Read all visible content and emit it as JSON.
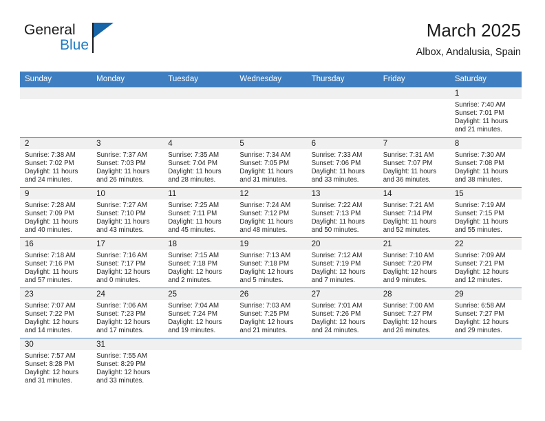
{
  "brand": {
    "line1": "General",
    "line2": "Blue",
    "accent_color": "#1d7bc4",
    "flag_color": "#1565a8"
  },
  "header": {
    "title": "March 2025",
    "subtitle": "Albox, Andalusia, Spain"
  },
  "calendar": {
    "header_bg": "#3f7fc1",
    "daynum_bg": "#f0f0f0",
    "weekday_headers": [
      "Sunday",
      "Monday",
      "Tuesday",
      "Wednesday",
      "Thursday",
      "Friday",
      "Saturday"
    ],
    "weeks": [
      [
        {
          "day": "",
          "blank": true,
          "sunrise": "",
          "sunset": "",
          "daylight_line1": "",
          "daylight_line2": ""
        },
        {
          "day": "",
          "blank": true,
          "sunrise": "",
          "sunset": "",
          "daylight_line1": "",
          "daylight_line2": ""
        },
        {
          "day": "",
          "blank": true,
          "sunrise": "",
          "sunset": "",
          "daylight_line1": "",
          "daylight_line2": ""
        },
        {
          "day": "",
          "blank": true,
          "sunrise": "",
          "sunset": "",
          "daylight_line1": "",
          "daylight_line2": ""
        },
        {
          "day": "",
          "blank": true,
          "sunrise": "",
          "sunset": "",
          "daylight_line1": "",
          "daylight_line2": ""
        },
        {
          "day": "",
          "blank": true,
          "sunrise": "",
          "sunset": "",
          "daylight_line1": "",
          "daylight_line2": ""
        },
        {
          "day": "1",
          "blank": false,
          "sunrise": "Sunrise: 7:40 AM",
          "sunset": "Sunset: 7:01 PM",
          "daylight_line1": "Daylight: 11 hours",
          "daylight_line2": "and 21 minutes."
        }
      ],
      [
        {
          "day": "2",
          "blank": false,
          "sunrise": "Sunrise: 7:38 AM",
          "sunset": "Sunset: 7:02 PM",
          "daylight_line1": "Daylight: 11 hours",
          "daylight_line2": "and 24 minutes."
        },
        {
          "day": "3",
          "blank": false,
          "sunrise": "Sunrise: 7:37 AM",
          "sunset": "Sunset: 7:03 PM",
          "daylight_line1": "Daylight: 11 hours",
          "daylight_line2": "and 26 minutes."
        },
        {
          "day": "4",
          "blank": false,
          "sunrise": "Sunrise: 7:35 AM",
          "sunset": "Sunset: 7:04 PM",
          "daylight_line1": "Daylight: 11 hours",
          "daylight_line2": "and 28 minutes."
        },
        {
          "day": "5",
          "blank": false,
          "sunrise": "Sunrise: 7:34 AM",
          "sunset": "Sunset: 7:05 PM",
          "daylight_line1": "Daylight: 11 hours",
          "daylight_line2": "and 31 minutes."
        },
        {
          "day": "6",
          "blank": false,
          "sunrise": "Sunrise: 7:33 AM",
          "sunset": "Sunset: 7:06 PM",
          "daylight_line1": "Daylight: 11 hours",
          "daylight_line2": "and 33 minutes."
        },
        {
          "day": "7",
          "blank": false,
          "sunrise": "Sunrise: 7:31 AM",
          "sunset": "Sunset: 7:07 PM",
          "daylight_line1": "Daylight: 11 hours",
          "daylight_line2": "and 36 minutes."
        },
        {
          "day": "8",
          "blank": false,
          "sunrise": "Sunrise: 7:30 AM",
          "sunset": "Sunset: 7:08 PM",
          "daylight_line1": "Daylight: 11 hours",
          "daylight_line2": "and 38 minutes."
        }
      ],
      [
        {
          "day": "9",
          "blank": false,
          "sunrise": "Sunrise: 7:28 AM",
          "sunset": "Sunset: 7:09 PM",
          "daylight_line1": "Daylight: 11 hours",
          "daylight_line2": "and 40 minutes."
        },
        {
          "day": "10",
          "blank": false,
          "sunrise": "Sunrise: 7:27 AM",
          "sunset": "Sunset: 7:10 PM",
          "daylight_line1": "Daylight: 11 hours",
          "daylight_line2": "and 43 minutes."
        },
        {
          "day": "11",
          "blank": false,
          "sunrise": "Sunrise: 7:25 AM",
          "sunset": "Sunset: 7:11 PM",
          "daylight_line1": "Daylight: 11 hours",
          "daylight_line2": "and 45 minutes."
        },
        {
          "day": "12",
          "blank": false,
          "sunrise": "Sunrise: 7:24 AM",
          "sunset": "Sunset: 7:12 PM",
          "daylight_line1": "Daylight: 11 hours",
          "daylight_line2": "and 48 minutes."
        },
        {
          "day": "13",
          "blank": false,
          "sunrise": "Sunrise: 7:22 AM",
          "sunset": "Sunset: 7:13 PM",
          "daylight_line1": "Daylight: 11 hours",
          "daylight_line2": "and 50 minutes."
        },
        {
          "day": "14",
          "blank": false,
          "sunrise": "Sunrise: 7:21 AM",
          "sunset": "Sunset: 7:14 PM",
          "daylight_line1": "Daylight: 11 hours",
          "daylight_line2": "and 52 minutes."
        },
        {
          "day": "15",
          "blank": false,
          "sunrise": "Sunrise: 7:19 AM",
          "sunset": "Sunset: 7:15 PM",
          "daylight_line1": "Daylight: 11 hours",
          "daylight_line2": "and 55 minutes."
        }
      ],
      [
        {
          "day": "16",
          "blank": false,
          "sunrise": "Sunrise: 7:18 AM",
          "sunset": "Sunset: 7:16 PM",
          "daylight_line1": "Daylight: 11 hours",
          "daylight_line2": "and 57 minutes."
        },
        {
          "day": "17",
          "blank": false,
          "sunrise": "Sunrise: 7:16 AM",
          "sunset": "Sunset: 7:17 PM",
          "daylight_line1": "Daylight: 12 hours",
          "daylight_line2": "and 0 minutes."
        },
        {
          "day": "18",
          "blank": false,
          "sunrise": "Sunrise: 7:15 AM",
          "sunset": "Sunset: 7:18 PM",
          "daylight_line1": "Daylight: 12 hours",
          "daylight_line2": "and 2 minutes."
        },
        {
          "day": "19",
          "blank": false,
          "sunrise": "Sunrise: 7:13 AM",
          "sunset": "Sunset: 7:18 PM",
          "daylight_line1": "Daylight: 12 hours",
          "daylight_line2": "and 5 minutes."
        },
        {
          "day": "20",
          "blank": false,
          "sunrise": "Sunrise: 7:12 AM",
          "sunset": "Sunset: 7:19 PM",
          "daylight_line1": "Daylight: 12 hours",
          "daylight_line2": "and 7 minutes."
        },
        {
          "day": "21",
          "blank": false,
          "sunrise": "Sunrise: 7:10 AM",
          "sunset": "Sunset: 7:20 PM",
          "daylight_line1": "Daylight: 12 hours",
          "daylight_line2": "and 9 minutes."
        },
        {
          "day": "22",
          "blank": false,
          "sunrise": "Sunrise: 7:09 AM",
          "sunset": "Sunset: 7:21 PM",
          "daylight_line1": "Daylight: 12 hours",
          "daylight_line2": "and 12 minutes."
        }
      ],
      [
        {
          "day": "23",
          "blank": false,
          "sunrise": "Sunrise: 7:07 AM",
          "sunset": "Sunset: 7:22 PM",
          "daylight_line1": "Daylight: 12 hours",
          "daylight_line2": "and 14 minutes."
        },
        {
          "day": "24",
          "blank": false,
          "sunrise": "Sunrise: 7:06 AM",
          "sunset": "Sunset: 7:23 PM",
          "daylight_line1": "Daylight: 12 hours",
          "daylight_line2": "and 17 minutes."
        },
        {
          "day": "25",
          "blank": false,
          "sunrise": "Sunrise: 7:04 AM",
          "sunset": "Sunset: 7:24 PM",
          "daylight_line1": "Daylight: 12 hours",
          "daylight_line2": "and 19 minutes."
        },
        {
          "day": "26",
          "blank": false,
          "sunrise": "Sunrise: 7:03 AM",
          "sunset": "Sunset: 7:25 PM",
          "daylight_line1": "Daylight: 12 hours",
          "daylight_line2": "and 21 minutes."
        },
        {
          "day": "27",
          "blank": false,
          "sunrise": "Sunrise: 7:01 AM",
          "sunset": "Sunset: 7:26 PM",
          "daylight_line1": "Daylight: 12 hours",
          "daylight_line2": "and 24 minutes."
        },
        {
          "day": "28",
          "blank": false,
          "sunrise": "Sunrise: 7:00 AM",
          "sunset": "Sunset: 7:27 PM",
          "daylight_line1": "Daylight: 12 hours",
          "daylight_line2": "and 26 minutes."
        },
        {
          "day": "29",
          "blank": false,
          "sunrise": "Sunrise: 6:58 AM",
          "sunset": "Sunset: 7:27 PM",
          "daylight_line1": "Daylight: 12 hours",
          "daylight_line2": "and 29 minutes."
        }
      ],
      [
        {
          "day": "30",
          "blank": false,
          "sunrise": "Sunrise: 7:57 AM",
          "sunset": "Sunset: 8:28 PM",
          "daylight_line1": "Daylight: 12 hours",
          "daylight_line2": "and 31 minutes."
        },
        {
          "day": "31",
          "blank": false,
          "sunrise": "Sunrise: 7:55 AM",
          "sunset": "Sunset: 8:29 PM",
          "daylight_line1": "Daylight: 12 hours",
          "daylight_line2": "and 33 minutes."
        },
        {
          "day": "",
          "blank": true,
          "sunrise": "",
          "sunset": "",
          "daylight_line1": "",
          "daylight_line2": ""
        },
        {
          "day": "",
          "blank": true,
          "sunrise": "",
          "sunset": "",
          "daylight_line1": "",
          "daylight_line2": ""
        },
        {
          "day": "",
          "blank": true,
          "sunrise": "",
          "sunset": "",
          "daylight_line1": "",
          "daylight_line2": ""
        },
        {
          "day": "",
          "blank": true,
          "sunrise": "",
          "sunset": "",
          "daylight_line1": "",
          "daylight_line2": ""
        },
        {
          "day": "",
          "blank": true,
          "sunrise": "",
          "sunset": "",
          "daylight_line1": "",
          "daylight_line2": ""
        }
      ]
    ]
  }
}
